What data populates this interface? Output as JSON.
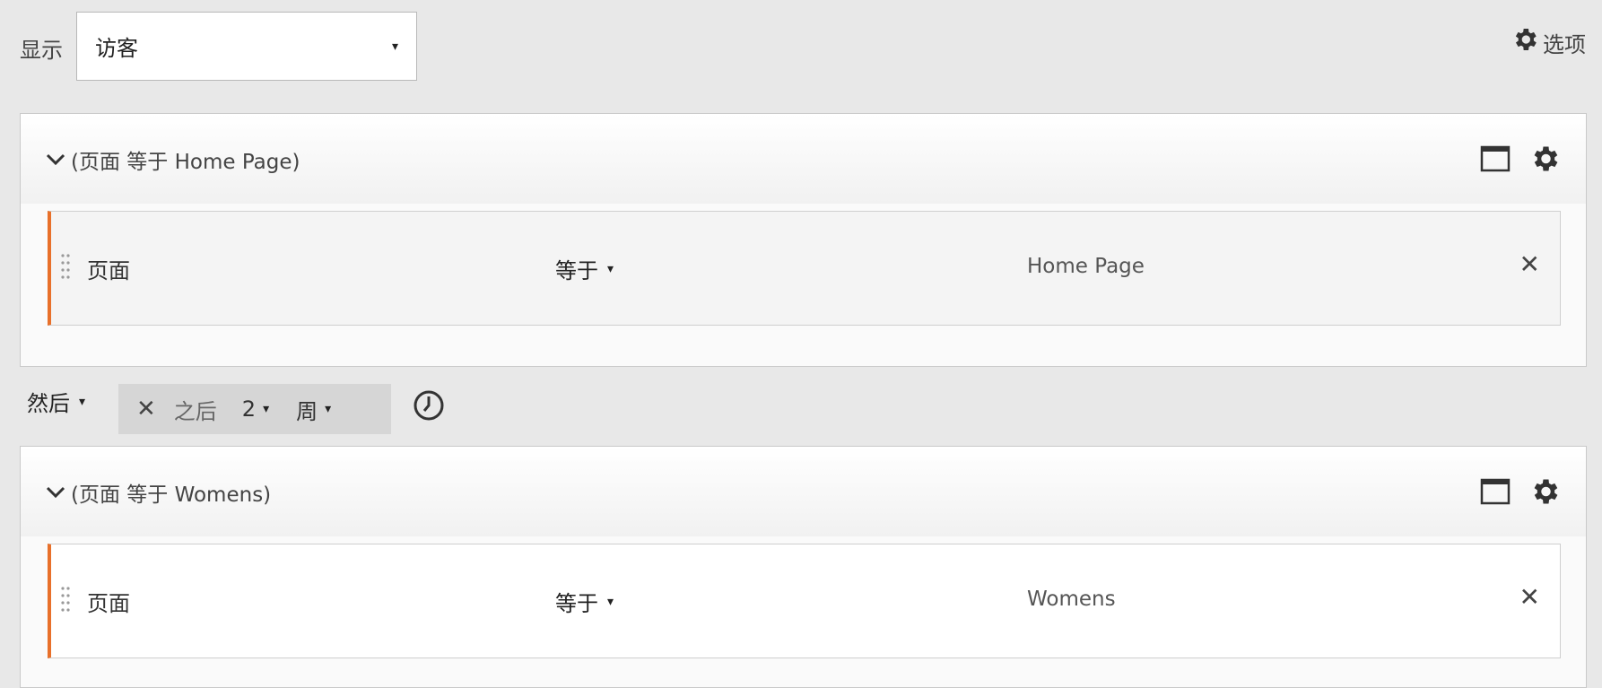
{
  "top": {
    "show_label": "显示",
    "show_value": "访客",
    "options_label": "选项"
  },
  "containers": [
    {
      "title": "(页面 等于 Home Page)",
      "rule": {
        "field": "页面",
        "operator": "等于",
        "value": "Home Page"
      }
    },
    {
      "title": "(页面 等于 Womens)",
      "rule": {
        "field": "页面",
        "operator": "等于",
        "value": "Womens"
      }
    }
  ],
  "sequence": {
    "then_label": "然后",
    "after_label": "之后",
    "count": "2",
    "unit": "周"
  },
  "icons": {
    "caret": "▾",
    "close": "✕",
    "chevron": "chevron-down",
    "gear": "gear",
    "window": "window",
    "clock": "clock",
    "grip": "drag-grip"
  },
  "colors": {
    "accent": "#e8702a",
    "background": "#e8e8e8",
    "panel": "#fafafa"
  }
}
